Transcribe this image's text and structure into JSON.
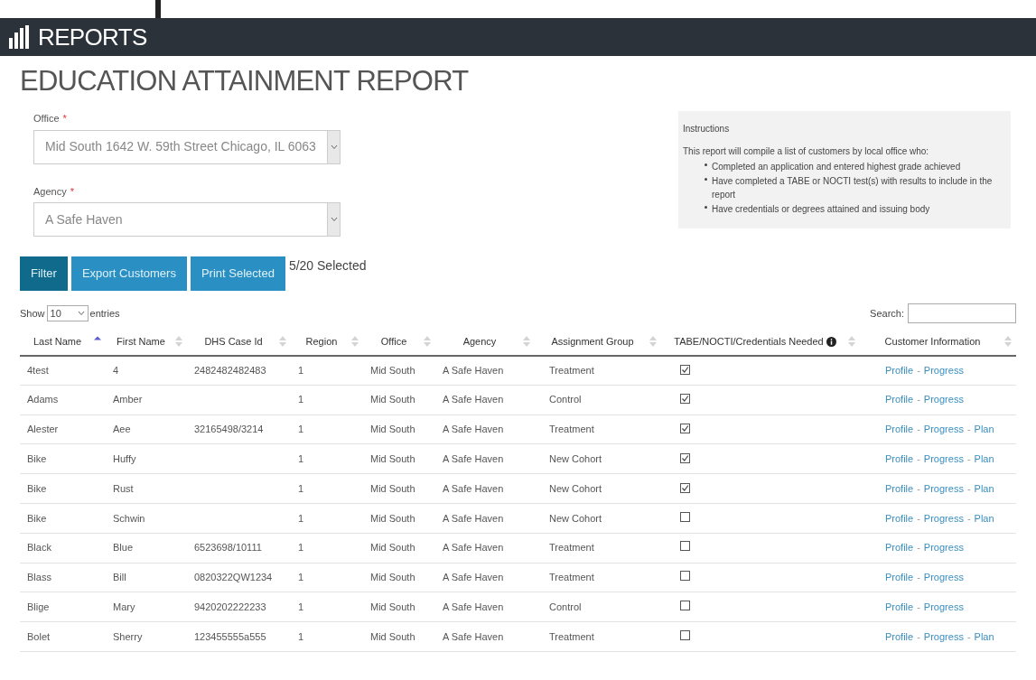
{
  "app_bar": {
    "title": "REPORTS"
  },
  "page_title": "EDUCATION ATTAINMENT REPORT",
  "office": {
    "label": "Office",
    "required_mark": "*",
    "value": "Mid South 1642 W. 59th Street Chicago, IL 6063"
  },
  "agency": {
    "label": "Agency",
    "required_mark": "*",
    "value": "A Safe Haven"
  },
  "instructions": {
    "title": "Instructions",
    "intro": "This report will compile a list of customers by local office who:",
    "bullets": [
      "Completed an application and entered highest grade achieved",
      "Have completed a TABE or NOCTI test(s) with results to include in the report",
      "Have credentials or degrees attained and issuing body"
    ]
  },
  "buttons": [
    {
      "label": "Filter",
      "kind": "primary"
    },
    {
      "label": "Export Customers",
      "kind": "secondary"
    },
    {
      "label": "Print Selected",
      "kind": "secondary"
    }
  ],
  "selection_count": "5/20 Selected",
  "length_control": {
    "prefix": "Show",
    "value": "10",
    "suffix": "entries"
  },
  "search": {
    "label": "Search:"
  },
  "table": {
    "link_separator": "-",
    "columns": [
      {
        "label": "Last Name",
        "sorted": true,
        "info": false
      },
      {
        "label": "First Name",
        "sorted": false,
        "info": false
      },
      {
        "label": "DHS Case Id",
        "sorted": false,
        "info": false
      },
      {
        "label": "Region",
        "sorted": false,
        "info": false
      },
      {
        "label": "Office",
        "sorted": false,
        "info": false
      },
      {
        "label": "Agency",
        "sorted": false,
        "info": false
      },
      {
        "label": "Assignment Group",
        "sorted": false,
        "info": false
      },
      {
        "label": "TABE/NOCTI/Credentials Needed",
        "sorted": false,
        "info": true
      },
      {
        "label": "Customer Information",
        "sorted": false,
        "info": false
      }
    ],
    "rows": [
      {
        "cells": [
          "4test",
          "4",
          "2482482482483",
          "1",
          "Mid South",
          "A Safe Haven",
          "Treatment"
        ],
        "checked": true,
        "links": [
          "Profile",
          "Progress"
        ]
      },
      {
        "cells": [
          "Adams",
          "Amber",
          "",
          "1",
          "Mid South",
          "A Safe Haven",
          "Control"
        ],
        "checked": true,
        "links": [
          "Profile",
          "Progress"
        ]
      },
      {
        "cells": [
          "Alester",
          "Aee",
          "32165498/3214",
          "1",
          "Mid South",
          "A Safe Haven",
          "Treatment"
        ],
        "checked": true,
        "links": [
          "Profile",
          "Progress",
          "Plan"
        ]
      },
      {
        "cells": [
          "Bike",
          "Huffy",
          "",
          "1",
          "Mid South",
          "A Safe Haven",
          "New Cohort"
        ],
        "checked": true,
        "links": [
          "Profile",
          "Progress",
          "Plan"
        ]
      },
      {
        "cells": [
          "Bike",
          "Rust",
          "",
          "1",
          "Mid South",
          "A Safe Haven",
          "New Cohort"
        ],
        "checked": true,
        "links": [
          "Profile",
          "Progress",
          "Plan"
        ]
      },
      {
        "cells": [
          "Bike",
          "Schwin",
          "",
          "1",
          "Mid South",
          "A Safe Haven",
          "New Cohort"
        ],
        "checked": false,
        "links": [
          "Profile",
          "Progress",
          "Plan"
        ]
      },
      {
        "cells": [
          "Black",
          "Blue",
          "6523698/10111",
          "1",
          "Mid South",
          "A Safe Haven",
          "Treatment"
        ],
        "checked": false,
        "links": [
          "Profile",
          "Progress"
        ]
      },
      {
        "cells": [
          "Blass",
          "Bill",
          "0820322QW1234",
          "1",
          "Mid South",
          "A Safe Haven",
          "Treatment"
        ],
        "checked": false,
        "links": [
          "Profile",
          "Progress"
        ]
      },
      {
        "cells": [
          "Blige",
          "Mary",
          "9420202222233",
          "1",
          "Mid South",
          "A Safe Haven",
          "Control"
        ],
        "checked": false,
        "links": [
          "Profile",
          "Progress"
        ]
      },
      {
        "cells": [
          "Bolet",
          "Sherry",
          "123455555a555",
          "1",
          "Mid South",
          "A Safe Haven",
          "Treatment"
        ],
        "checked": false,
        "links": [
          "Profile",
          "Progress",
          "Plan"
        ]
      }
    ]
  }
}
